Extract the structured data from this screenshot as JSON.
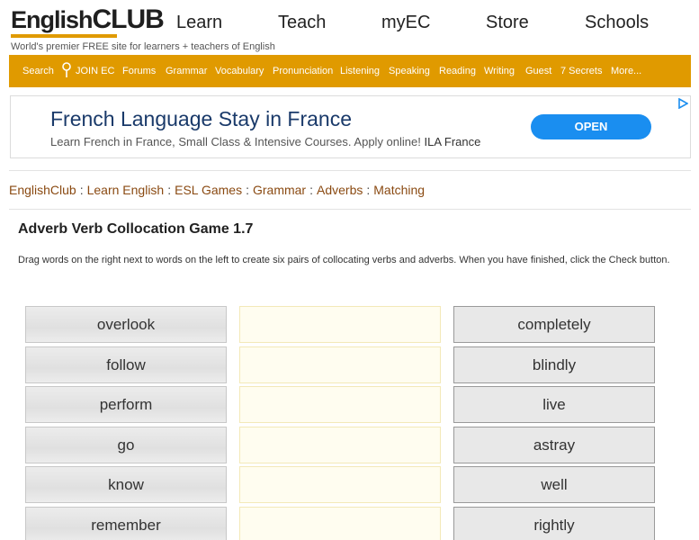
{
  "header": {
    "logo_part1": "English",
    "logo_part2": "CLUB",
    "tagline": "World's premier FREE site for learners + teachers of English",
    "nav": [
      "Learn",
      "Teach",
      "myEC",
      "Store",
      "Schools"
    ]
  },
  "menubar": {
    "items": [
      "Search",
      "JOIN EC",
      "Forums",
      "Grammar",
      "Vocabulary",
      "Pronunciation",
      "Listening",
      "Speaking",
      "Reading",
      "Writing",
      "Guest",
      "7 Secrets",
      "More..."
    ]
  },
  "ad": {
    "title": "French Language Stay in France",
    "subtitle": "Learn French in France, Small Class & Intensive Courses. Apply online!",
    "advertiser": "ILA France",
    "button": "OPEN"
  },
  "breadcrumb": [
    "EnglishClub",
    "Learn English",
    "ESL Games",
    "Grammar",
    "Adverbs",
    "Matching"
  ],
  "page": {
    "title": "Adverb Verb Collocation Game 1.7",
    "instructions": "Drag words on the right next to words on the left to create six pairs of collocating verbs and adverbs. When you have finished, click the Check button."
  },
  "game": {
    "verbs": [
      "overlook",
      "follow",
      "perform",
      "go",
      "know",
      "remember"
    ],
    "adverbs": [
      "completely",
      "blindly",
      "live",
      "astray",
      "well",
      "rightly"
    ]
  },
  "colors": {
    "accent": "#e09a00",
    "link": "#8a4a12",
    "ad_button": "#1a8ef0"
  }
}
